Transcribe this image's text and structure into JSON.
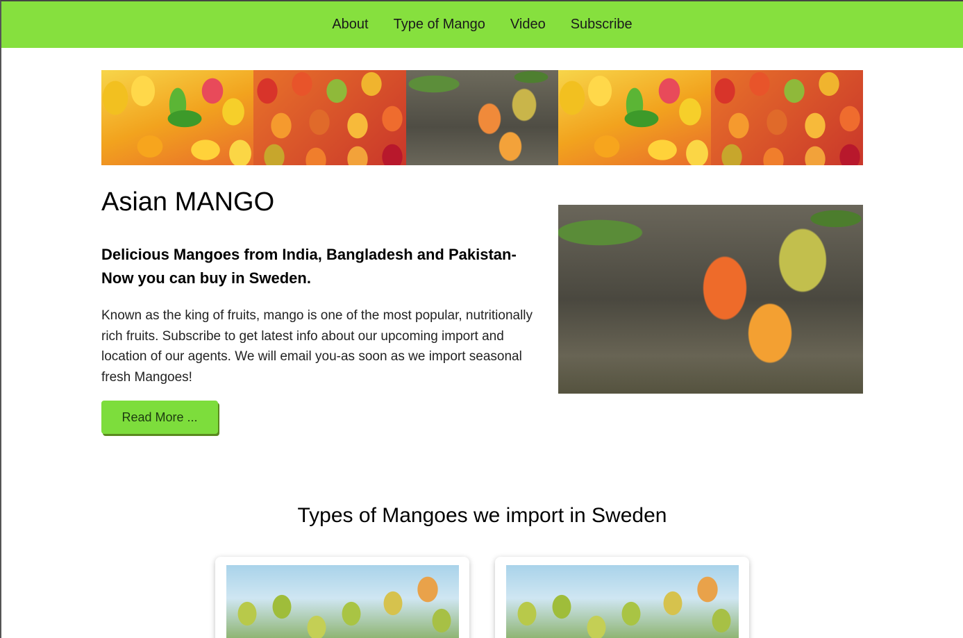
{
  "nav": {
    "items": [
      {
        "label": "About"
      },
      {
        "label": "Type of Mango"
      },
      {
        "label": "Video"
      },
      {
        "label": "Subscribe"
      }
    ],
    "color": "#86e03e"
  },
  "gallery": {
    "tiles": [
      "mango-pile-yellow-photo",
      "mango-pile-red-photo",
      "mango-tree-photo",
      "mango-pile-yellow-photo",
      "mango-pile-red-photo"
    ]
  },
  "hero": {
    "title": "Asian MANGO",
    "subtitle": "Delicious Mangoes from India, Bangladesh and Pakistan- Now you can buy in Sweden.",
    "text": "Known as the king of fruits, mango is one of the most popular, nutritionally rich fruits. Subscribe to get latest info about our upcoming import and location of our agents. We will email you-as soon as we import seasonal fresh Mangoes!",
    "button_label": "Read More ...",
    "image": "mango-on-branch-photo"
  },
  "types": {
    "title": "Types of Mangoes we import in Sweden",
    "cards": [
      {
        "image": "green-mangoes-tree-photo"
      },
      {
        "image": "green-mangoes-tree-photo"
      }
    ]
  }
}
